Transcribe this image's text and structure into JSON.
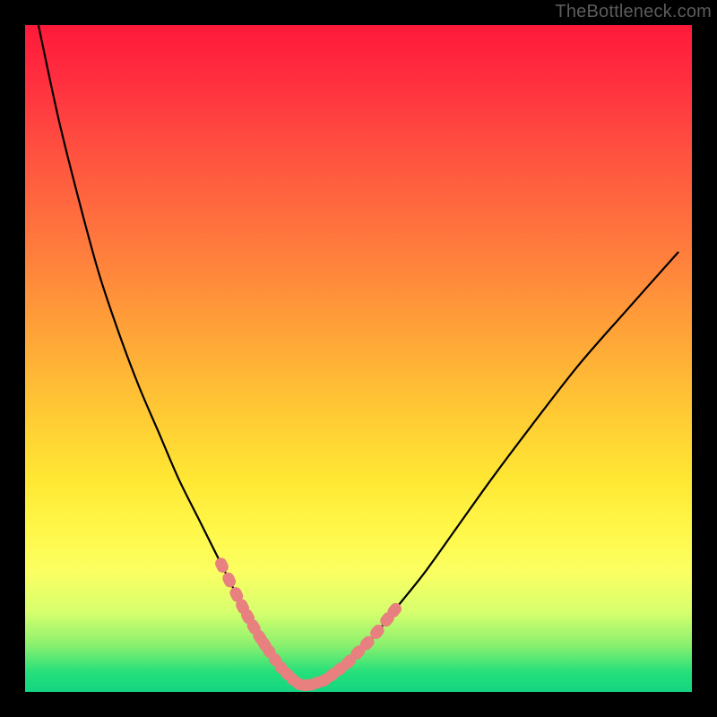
{
  "watermark": "TheBottleneck.com",
  "chart_data": {
    "type": "line",
    "title": "",
    "xlabel": "",
    "ylabel": "",
    "xlim": [
      0,
      100
    ],
    "ylim": [
      0,
      100
    ],
    "grid": false,
    "legend": false,
    "series": [
      {
        "name": "curve",
        "x": [
          2,
          5,
          8,
          11,
          14,
          17,
          20,
          23,
          26,
          29,
          31,
          33,
          35,
          37,
          38.5,
          40,
          41,
          42,
          43,
          45,
          48,
          52,
          56,
          60,
          65,
          70,
          76,
          83,
          90,
          98
        ],
        "y": [
          100,
          86,
          74,
          63,
          54,
          46,
          39,
          32,
          26,
          20,
          16,
          12,
          8.5,
          5.5,
          3.5,
          2,
          1.2,
          1,
          1.1,
          1.8,
          4,
          8,
          13,
          18,
          25,
          32,
          40,
          49,
          57,
          66
        ]
      }
    ],
    "markers": {
      "description": "coral capsule-shaped markers clustered near curve minimum, both sides",
      "color": "#e7807e",
      "left_cluster_x_range": [
        29,
        36
      ],
      "right_cluster_x_range": [
        42,
        55
      ],
      "bottom_cluster_x_range": [
        36,
        44
      ]
    },
    "background_gradient": {
      "top": "#ff1a3a",
      "upper_mid": "#ff8a3b",
      "mid": "#ffe733",
      "lower_mid": "#d7ff6d",
      "bottom": "#13d582"
    }
  }
}
